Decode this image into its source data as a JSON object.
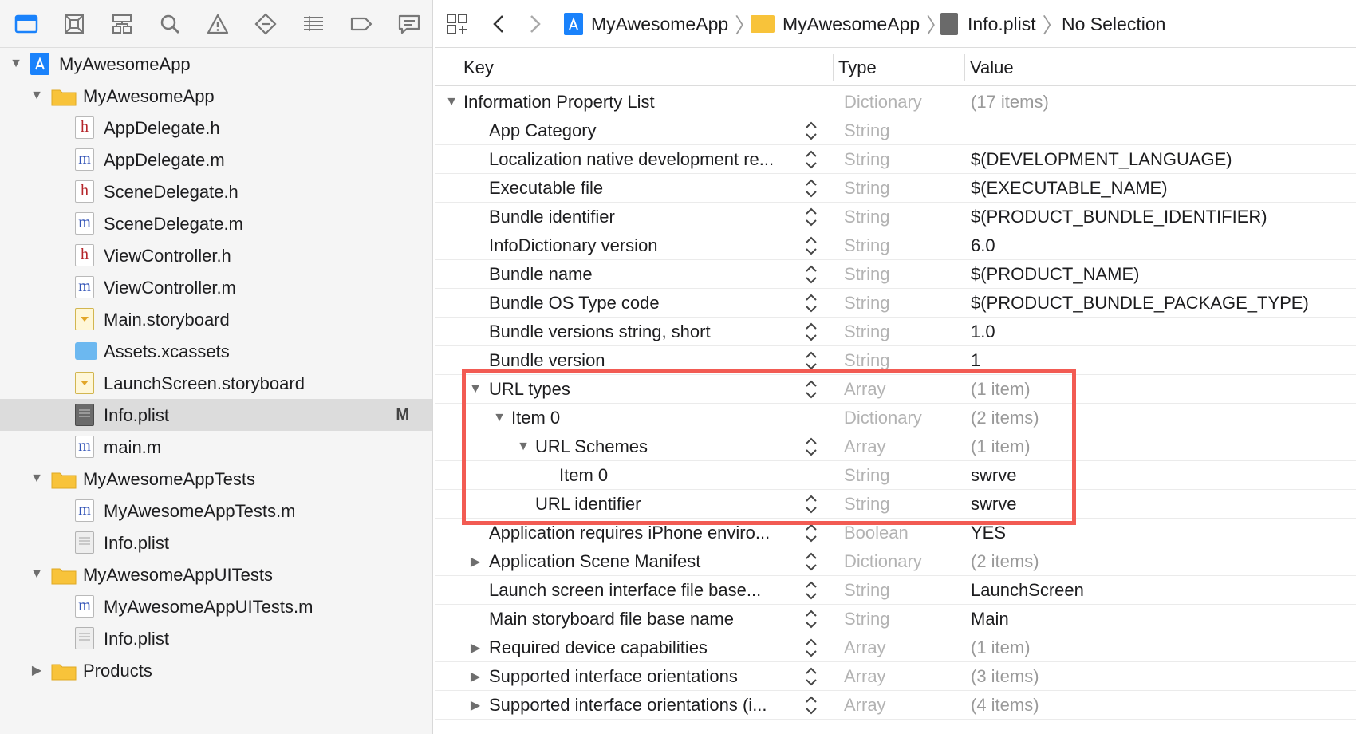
{
  "navigator": {
    "tree": [
      {
        "label": "MyAwesomeApp",
        "icon": "project-icon",
        "expanded": true
      },
      {
        "label": "MyAwesomeApp",
        "icon": "folder-icon",
        "expanded": true
      },
      {
        "label": "AppDelegate.h",
        "icon": "header-file-icon",
        "glyph": "h"
      },
      {
        "label": "AppDelegate.m",
        "icon": "objc-file-icon",
        "glyph": "m"
      },
      {
        "label": "SceneDelegate.h",
        "icon": "header-file-icon",
        "glyph": "h"
      },
      {
        "label": "SceneDelegate.m",
        "icon": "objc-file-icon",
        "glyph": "m"
      },
      {
        "label": "ViewController.h",
        "icon": "header-file-icon",
        "glyph": "h"
      },
      {
        "label": "ViewController.m",
        "icon": "objc-file-icon",
        "glyph": "m"
      },
      {
        "label": "Main.storyboard",
        "icon": "storyboard-icon"
      },
      {
        "label": "Assets.xcassets",
        "icon": "assets-icon"
      },
      {
        "label": "LaunchScreen.storyboard",
        "icon": "storyboard-icon"
      },
      {
        "label": "Info.plist",
        "icon": "plist-icon",
        "badge": "M",
        "selected": true
      },
      {
        "label": "main.m",
        "icon": "objc-file-icon",
        "glyph": "m"
      },
      {
        "label": "MyAwesomeAppTests",
        "icon": "folder-icon",
        "expanded": true
      },
      {
        "label": "MyAwesomeAppTests.m",
        "icon": "objc-file-icon",
        "glyph": "m"
      },
      {
        "label": "Info.plist",
        "icon": "plist-icon"
      },
      {
        "label": "MyAwesomeAppUITests",
        "icon": "folder-icon",
        "expanded": true
      },
      {
        "label": "MyAwesomeAppUITests.m",
        "icon": "objc-file-icon",
        "glyph": "m"
      },
      {
        "label": "Info.plist",
        "icon": "plist-icon"
      },
      {
        "label": "Products",
        "icon": "folder-icon",
        "expanded": false
      }
    ]
  },
  "jump_bar": {
    "crumbs": [
      "MyAwesomeApp",
      "MyAwesomeApp",
      "Info.plist",
      "No Selection"
    ]
  },
  "plist": {
    "columns": {
      "key": "Key",
      "type": "Type",
      "value": "Value"
    },
    "rows": [
      {
        "key": "Information Property List",
        "type": "Dictionary",
        "value": "(17 items)",
        "toggle": "expanded",
        "dim": true
      },
      {
        "key": "App Category",
        "type": "String",
        "value": ""
      },
      {
        "key": "Localization native development re...",
        "type": "String",
        "value": "$(DEVELOPMENT_LANGUAGE)"
      },
      {
        "key": "Executable file",
        "type": "String",
        "value": "$(EXECUTABLE_NAME)"
      },
      {
        "key": "Bundle identifier",
        "type": "String",
        "value": "$(PRODUCT_BUNDLE_IDENTIFIER)"
      },
      {
        "key": "InfoDictionary version",
        "type": "String",
        "value": "6.0"
      },
      {
        "key": "Bundle name",
        "type": "String",
        "value": "$(PRODUCT_NAME)"
      },
      {
        "key": "Bundle OS Type code",
        "type": "String",
        "value": "$(PRODUCT_BUNDLE_PACKAGE_TYPE)"
      },
      {
        "key": "Bundle versions string, short",
        "type": "String",
        "value": "1.0"
      },
      {
        "key": "Bundle version",
        "type": "String",
        "value": "1"
      },
      {
        "key": "URL types",
        "type": "Array",
        "value": "(1 item)",
        "toggle": "expanded",
        "dim": true
      },
      {
        "key": "Item 0",
        "type": "Dictionary",
        "value": "(2 items)",
        "toggle": "expanded",
        "dim": true
      },
      {
        "key": "URL Schemes",
        "type": "Array",
        "value": "(1 item)",
        "toggle": "expanded",
        "dim": true
      },
      {
        "key": "Item 0",
        "type": "String",
        "value": "swrve"
      },
      {
        "key": "URL identifier",
        "type": "String",
        "value": "swrve"
      },
      {
        "key": "Application requires iPhone enviro...",
        "type": "Boolean",
        "value": "YES"
      },
      {
        "key": "Application Scene Manifest",
        "type": "Dictionary",
        "value": "(2 items)",
        "toggle": "collapsed",
        "dim": true
      },
      {
        "key": "Launch screen interface file base...",
        "type": "String",
        "value": "LaunchScreen"
      },
      {
        "key": "Main storyboard file base name",
        "type": "String",
        "value": "Main"
      },
      {
        "key": "Required device capabilities",
        "type": "Array",
        "value": "(1 item)",
        "toggle": "collapsed",
        "dim": true
      },
      {
        "key": "Supported interface orientations",
        "type": "Array",
        "value": "(3 items)",
        "toggle": "collapsed",
        "dim": true
      },
      {
        "key": "Supported interface orientations (i...",
        "type": "Array",
        "value": "(4 items)",
        "toggle": "collapsed",
        "dim": true
      }
    ]
  },
  "colors": {
    "highlight": "#f25b53",
    "selection": "#dcdcdc",
    "accent": "#1a82fb"
  }
}
